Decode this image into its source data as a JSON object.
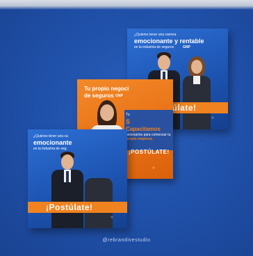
{
  "cards": {
    "top_right": {
      "question": "¿Quieres tener una carrera",
      "headline": "emocionante y rentable",
      "subline": "en la industria de seguros",
      "brand": "GNP",
      "cta": "¡Postúlate!"
    },
    "middle": {
      "headline_line1": "Tu propio negoci",
      "headline_line2": "de seguros",
      "brand": "GNP",
      "small_t": "Tu",
      "orange_word": "S",
      "orange_word2": "Capacitamos",
      "body_line1": "necesarios para comenzar tu",
      "body_line2": "propio empresa.",
      "cta": "¡POSTÚLATE!"
    },
    "bottom_left": {
      "question": "¿Quieres tener una ca",
      "headline": "emocionante",
      "subline": "en la industria de seg",
      "cta": "¡Postúlate!"
    }
  },
  "credit": "@rebrandivestudio",
  "colors": {
    "background": "#1f4fa7",
    "card_blue": "#2d6fd3",
    "card_orange": "#e86f14",
    "banner_orange": "#f0821f"
  }
}
